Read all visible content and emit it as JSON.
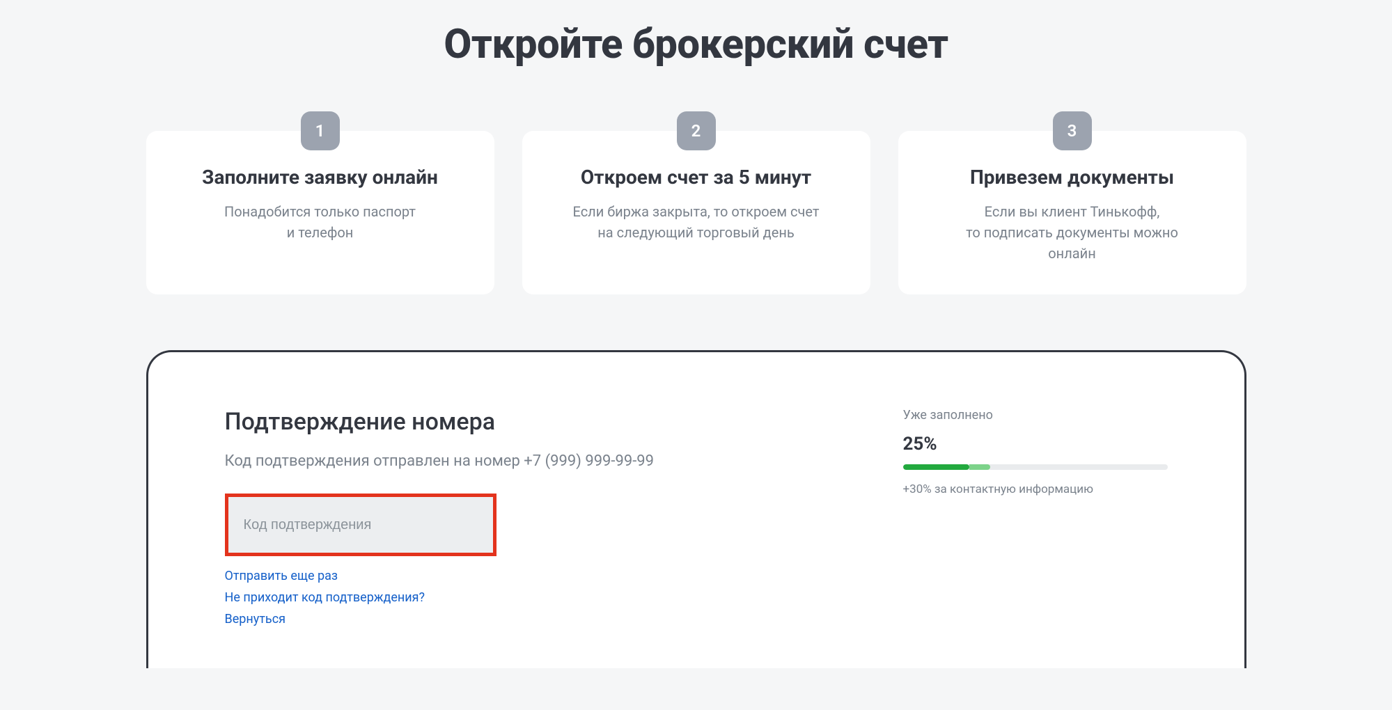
{
  "title": "Откройте брокерский счет",
  "steps": [
    {
      "num": "1",
      "title": "Заполните заявку онлайн",
      "desc": "Понадобится только паспорт\nи телефон"
    },
    {
      "num": "2",
      "title": "Откроем счет за 5 минут",
      "desc": "Если биржа закрыта, то откроем счет\nна следующий торговый день"
    },
    {
      "num": "3",
      "title": "Привезем документы",
      "desc": "Если вы клиент Тинькофф,\nто подписать документы можно\nонлайн"
    }
  ],
  "form": {
    "heading": "Подтверждение номера",
    "sub": "Код подтверждения отправлен на номер +7 (999) 999-99-99",
    "code_placeholder": "Код подтверждения",
    "links": {
      "resend": "Отправить еще раз",
      "no_code": "Не приходит код подтверждения?",
      "back": "Вернуться"
    }
  },
  "progress": {
    "label": "Уже заполнено",
    "pct_text": "25%",
    "filled_pct": 25,
    "extra_pct": 8,
    "note": "+30% за контактную информацию"
  }
}
